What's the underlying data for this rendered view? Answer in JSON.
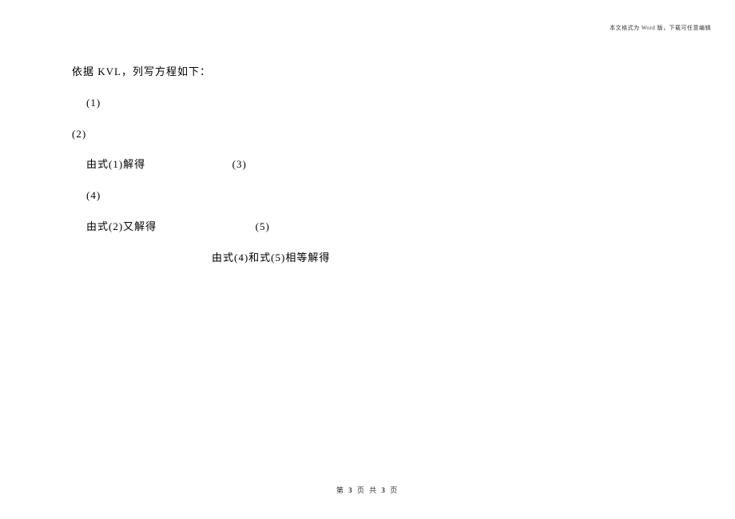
{
  "header": {
    "note": "本文格式为 Word 版，下载可任意编辑"
  },
  "content": {
    "line1": "依据 KVL，列写方程如下：",
    "line2": "(1)",
    "line3": "(2)",
    "line4_prefix": "由式(1)解得",
    "line4_suffix": "(3)",
    "line5": "(4)",
    "line6_prefix": "由式(2)又解得",
    "line6_suffix": "(5)",
    "line7": "由式(4)和式(5)相等解得"
  },
  "footer": {
    "prefix": "第 ",
    "current": "3",
    "mid": " 页 共 ",
    "total": "3",
    "suffix": " 页"
  }
}
